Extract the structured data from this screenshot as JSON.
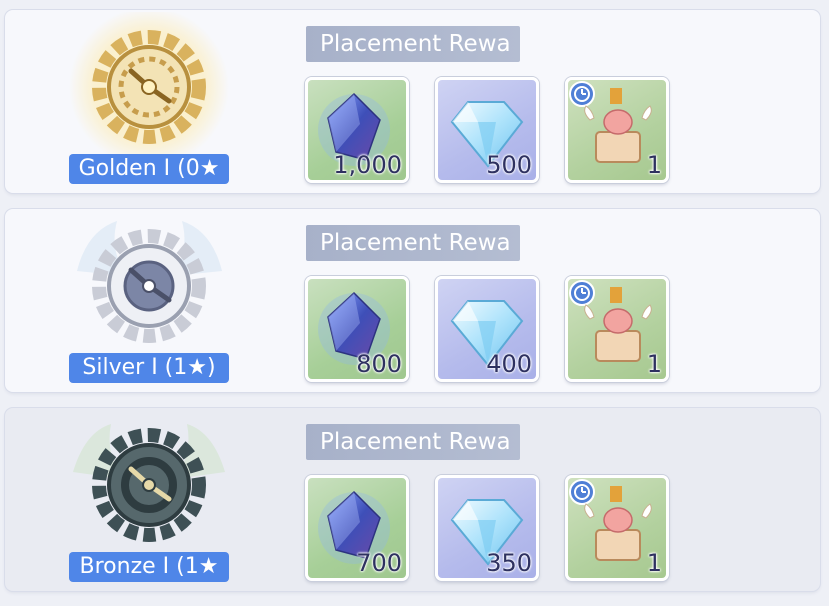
{
  "tiers": [
    {
      "rank_label": "Golden I (0★",
      "reward_title": "Placement Rewa",
      "emblem": "golden-gear-emblem",
      "rewards": [
        {
          "icon": "crystal-shard-icon",
          "quantity": "1,000"
        },
        {
          "icon": "diamond-icon",
          "quantity": "500"
        },
        {
          "icon": "pet-timer-icon",
          "quantity": "1"
        }
      ]
    },
    {
      "rank_label": "Silver I (1★)",
      "reward_title": "Placement Rewa",
      "emblem": "silver-gear-emblem",
      "rewards": [
        {
          "icon": "crystal-shard-icon",
          "quantity": "800"
        },
        {
          "icon": "diamond-icon",
          "quantity": "400"
        },
        {
          "icon": "pet-timer-icon",
          "quantity": "1"
        }
      ]
    },
    {
      "rank_label": "Bronze I (1★",
      "reward_title": "Placement Rewa",
      "emblem": "bronze-gear-emblem",
      "rewards": [
        {
          "icon": "crystal-shard-icon",
          "quantity": "700"
        },
        {
          "icon": "diamond-icon",
          "quantity": "350"
        },
        {
          "icon": "pet-timer-icon",
          "quantity": "1"
        }
      ]
    }
  ],
  "colors": {
    "rank_badge": "#4f86e8",
    "title_bar": "#a7b1c9",
    "gold": "#d9b25e",
    "silver": "#c9ccd6",
    "bronze": "#3e5055"
  }
}
